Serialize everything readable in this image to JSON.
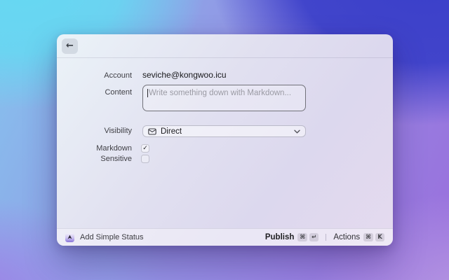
{
  "window": {
    "back_icon": "←"
  },
  "form": {
    "account": {
      "label": "Account",
      "value": "seviche@kongwoo.icu"
    },
    "content": {
      "label": "Content",
      "placeholder": "Write something down with Markdown..."
    },
    "visibility": {
      "label": "Visibility",
      "selected": "Direct",
      "icon": "envelope-icon"
    },
    "markdown": {
      "label": "Markdown",
      "checked": true,
      "check_glyph": "✓"
    },
    "sensitive": {
      "label": "Sensitive",
      "checked": false
    }
  },
  "toolbar": {
    "status_label": "Add Simple Status",
    "publish": {
      "label": "Publish",
      "keys": [
        "⌘",
        "↵"
      ]
    },
    "actions": {
      "label": "Actions",
      "keys": [
        "⌘",
        "K"
      ]
    }
  },
  "colors": {
    "bg_top_left": "#66d8f2",
    "bg_top_right": "#3a3fc9",
    "bg_bottom_left": "#a07ce6",
    "bg_bottom_right": "#b99de3",
    "window_tint": "#e1e0f0",
    "text_primary": "#1c1c1e",
    "text_label": "#404046"
  }
}
